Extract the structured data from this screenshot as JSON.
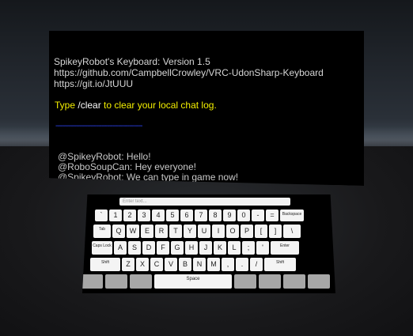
{
  "chat": {
    "header": [
      "SpikeyRobot's Keyboard: Version 1.5",
      "https://github.com/CampbellCrowley/VRC-UdonSharp-Keyboard",
      "https://git.io/JtUUU"
    ],
    "hint_prefix": "Type ",
    "hint_command": "/clear",
    "hint_suffix": " to clear your local chat log.",
    "divider": "-----------------------------------------------",
    "messages": [
      "@SpikeyRobot: Hello!",
      "@RoboSoupCan: Hey everyone!",
      "@SpikeyRobot: We can type in game now!"
    ]
  },
  "keyboard": {
    "input_placeholder": "Enter text...",
    "row1": [
      "`",
      "1",
      "2",
      "3",
      "4",
      "5",
      "6",
      "7",
      "8",
      "9",
      "0",
      "-",
      "=",
      "Backspace"
    ],
    "row2": [
      "Tab",
      "Q",
      "W",
      "E",
      "R",
      "T",
      "Y",
      "U",
      "I",
      "O",
      "P",
      "[",
      "]",
      "\\"
    ],
    "row3": [
      "Caps Lock",
      "A",
      "S",
      "D",
      "F",
      "G",
      "H",
      "J",
      "K",
      "L",
      ";",
      "'",
      "Enter"
    ],
    "row4": [
      "Shift",
      "Z",
      "X",
      "C",
      "V",
      "B",
      "N",
      "M",
      ",",
      ".",
      "/",
      "Shift"
    ],
    "row5": [
      "",
      "",
      "",
      "Space",
      "",
      "",
      "",
      ""
    ]
  }
}
